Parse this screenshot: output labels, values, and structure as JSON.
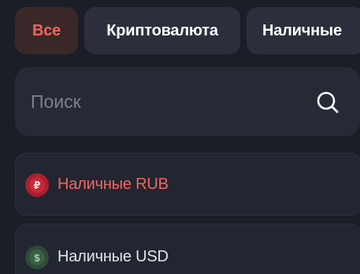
{
  "filter_tabs": [
    {
      "label": "Все",
      "active": true
    },
    {
      "label": "Криптовалюта",
      "active": false
    },
    {
      "label": "Наличные",
      "active": false
    }
  ],
  "search": {
    "placeholder": "Поиск",
    "value": "",
    "icon": "search-icon"
  },
  "currency_list": [
    {
      "label": "Наличные RUB",
      "symbol": "₽",
      "icon": "ruble-coin-icon",
      "selected": true
    },
    {
      "label": "Наличные USD",
      "symbol": "$",
      "icon": "dollar-coin-icon",
      "selected": false
    }
  ],
  "colors": {
    "background": "#1b1e27",
    "tab_background": "#2a2f3b",
    "active_tab_background": "#3a2828",
    "accent": "#f0675f",
    "search_background": "#252a35",
    "row_background": "#222631"
  }
}
